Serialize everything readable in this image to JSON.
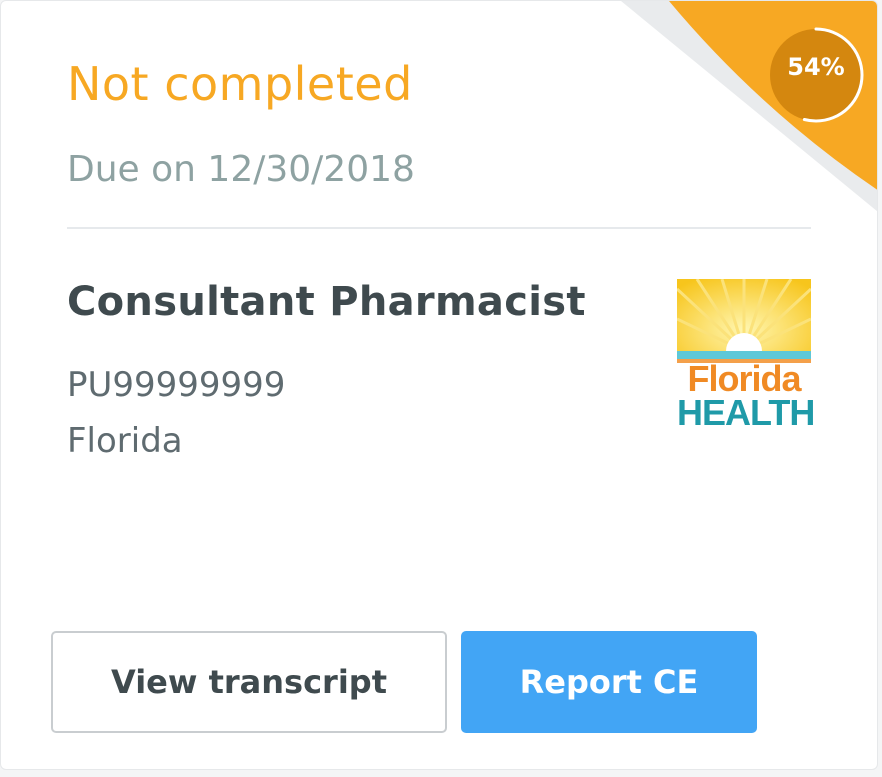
{
  "card": {
    "status_text": "Not completed",
    "due_text": "Due on 12/30/2018",
    "progress_percent": 54,
    "progress_label": "54%",
    "license": {
      "name": "Consultant Pharmacist",
      "number": "PU99999999",
      "state": "Florida"
    },
    "logo": {
      "line1": "Florida",
      "line2": "HEALTH"
    },
    "buttons": {
      "view_transcript": "View transcript",
      "report_ce": "Report CE"
    }
  },
  "colors": {
    "status": "#f7a823",
    "corner": "#f7a823",
    "progress_circle": "#d4870f",
    "primary_button": "#42a5f5"
  }
}
